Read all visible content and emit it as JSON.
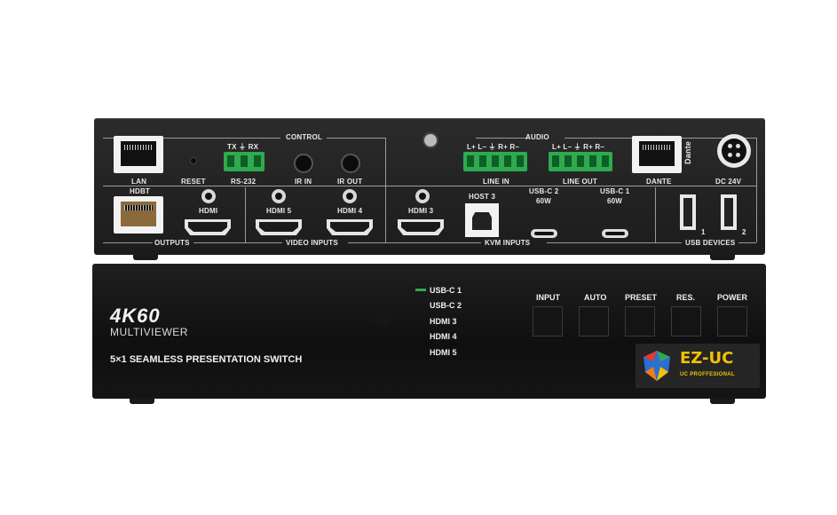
{
  "rear_panel": {
    "control": "CONTROL",
    "audio": "AUDIO",
    "lan": "LAN",
    "reset": "RESET",
    "rs232": "RS-232",
    "tx_rx": "TX ⏚ RX",
    "ir_in": "IR IN",
    "ir_out": "IR OUT",
    "line_in_pins": "L+ L– ⏚ R+ R–",
    "line_out_pins": "L+ L– ⏚ R+ R–",
    "line_in": "LINE IN",
    "line_out": "LINE OUT",
    "dante_port": "DANTE",
    "dante_logo": "Dante",
    "dc": "DC 24V",
    "hdbt": "HDBT",
    "hdmi_out": "HDMI",
    "hdmi5": "HDMI 5",
    "hdmi4": "HDMI 4",
    "hdmi3": "HDMI 3",
    "host3": "HOST 3",
    "usbc2": "USB-C 2",
    "usbc2_power": "60W",
    "usbc1": "USB-C 1",
    "usbc1_power": "60W",
    "usb1": "1",
    "usb2": "2",
    "outputs": "OUTPUTS",
    "video_inputs": "VIDEO INPUTS",
    "kvm_inputs": "KVM INPUTS",
    "usb_devices": "USB DEVICES"
  },
  "front_panel": {
    "brand_big": "4K60",
    "brand_sub": "MULTIVIEWER",
    "product": "5×1 SEAMLESS PRESENTATION SWITCH",
    "sources": [
      "USB-C 1",
      "USB-C 2",
      "HDMI 3",
      "HDMI 4",
      "HDMI 5"
    ],
    "active_source": "USB-C 1",
    "active_led_color": "#2faa4f",
    "buttons": [
      "INPUT",
      "AUTO",
      "PRESET",
      "RES.",
      "POWER"
    ]
  },
  "watermark": {
    "name": "EZ-UC",
    "tagline": "UC PROFFESIONAL",
    "name_color": "#f2c200",
    "tagline_color": "#f2c200"
  },
  "colors": {
    "terminal_green": "#2faa4f",
    "chassis": "#1c1c1c"
  }
}
